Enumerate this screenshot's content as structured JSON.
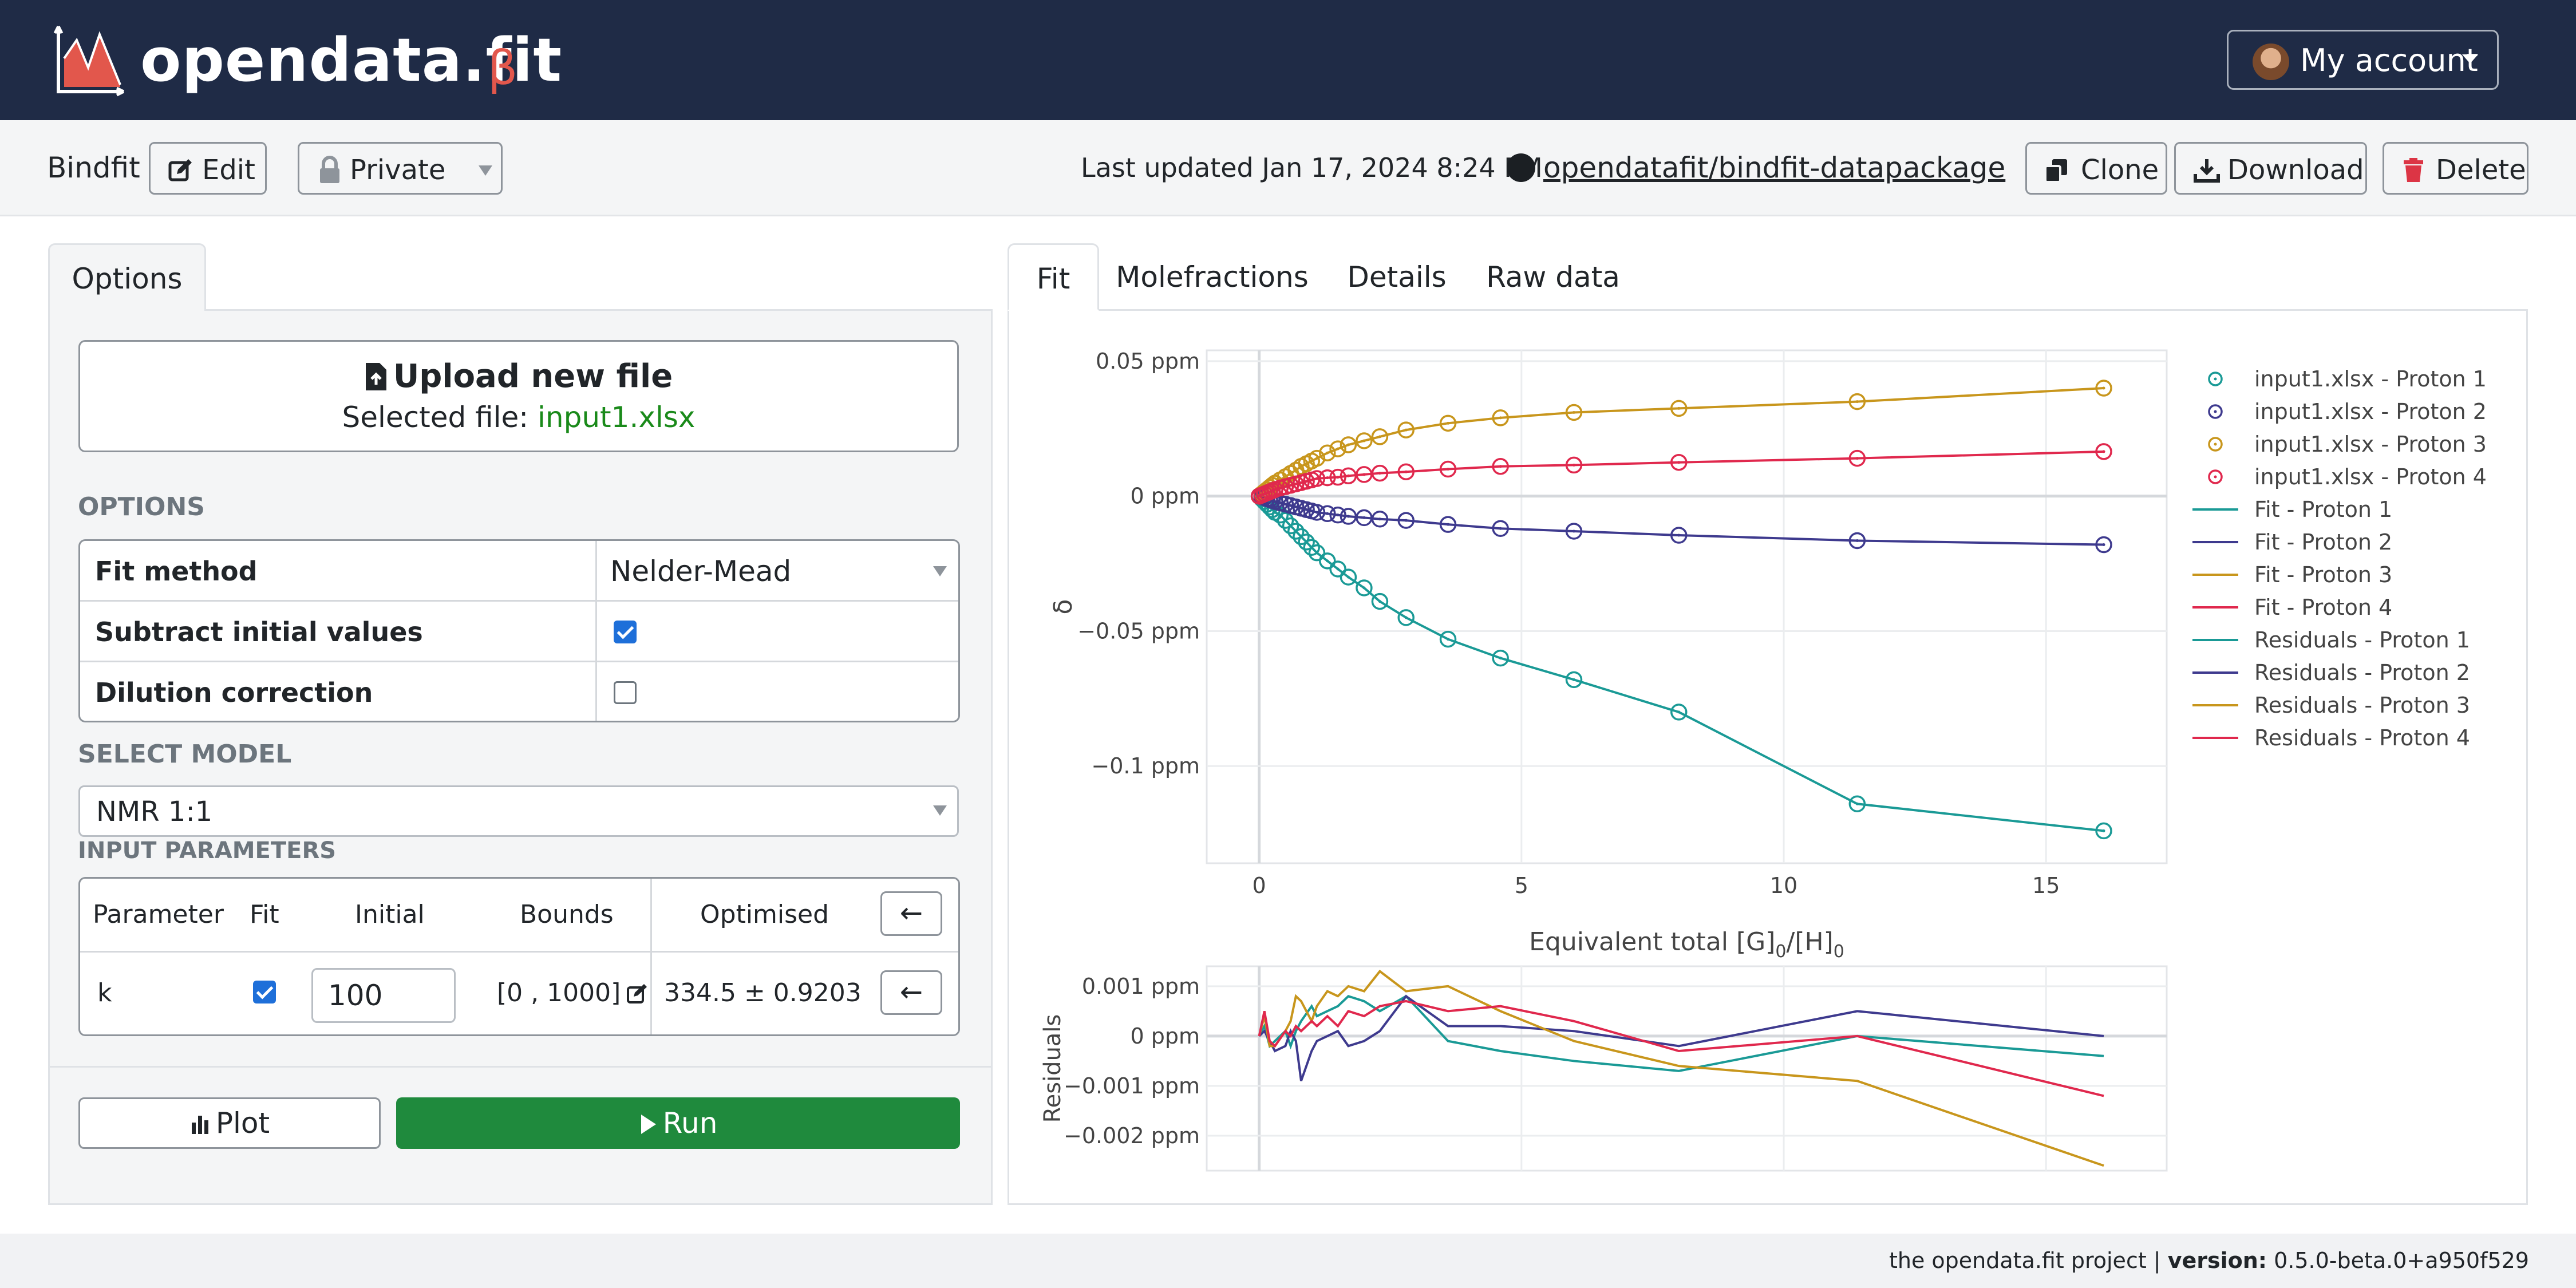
{
  "brand": {
    "name": "opendata.fit",
    "beta": "β"
  },
  "account": {
    "label": "My account"
  },
  "toolbar": {
    "project_name": "Bindfit",
    "edit_label": "Edit",
    "visibility": "Private",
    "last_updated": "Last updated Jan 17, 2024 8:24 PM",
    "repo": "opendatafit/bindfit-datapackage",
    "clone_label": "Clone",
    "download_label": "Download",
    "delete_label": "Delete"
  },
  "left": {
    "tab": "Options",
    "upload_title": "Upload new file",
    "selected_prefix": "Selected file: ",
    "selected_file": "input1.xlsx",
    "options_heading": "OPTIONS",
    "options": [
      {
        "label": "Fit method",
        "value": "Nelder-Mead"
      },
      {
        "label": "Subtract initial values",
        "checked": true
      },
      {
        "label": "Dilution correction",
        "checked": false
      }
    ],
    "model_heading": "SELECT MODEL",
    "model_value": "NMR 1:1",
    "params_heading": "INPUT PARAMETERS",
    "param_headers": [
      "Parameter",
      "Fit",
      "Initial",
      "Bounds",
      "Optimised"
    ],
    "param_row": {
      "name": "k",
      "fit": true,
      "initial": "100",
      "bounds": "[0 , 1000]",
      "optimised": "334.5 ± 0.9203"
    },
    "arrow": "←",
    "plot_label": "Plot",
    "run_label": "Run"
  },
  "right": {
    "tabs": [
      "Fit",
      "Molefractions",
      "Details",
      "Raw data"
    ],
    "active_tab": "Fit"
  },
  "chart_data": [
    {
      "type": "scatter",
      "title": "",
      "xlabel": "Equivalent total [G]0/[H]0",
      "ylabel": "δ",
      "xlim": [
        -1,
        17.3
      ],
      "ylim": [
        -0.136,
        0.054
      ],
      "x_ticks": [
        "0",
        "5",
        "10",
        "15"
      ],
      "y_ticks": [
        "0.05 ppm",
        "0 ppm",
        "−0.05 ppm",
        "−0.1 ppm"
      ],
      "x": [
        0,
        0.05,
        0.1,
        0.15,
        0.2,
        0.25,
        0.3,
        0.4,
        0.5,
        0.6,
        0.7,
        0.8,
        0.9,
        1.0,
        1.1,
        1.3,
        1.5,
        1.7,
        2.0,
        2.3,
        2.8,
        3.6,
        4.6,
        6.0,
        8.0,
        11.4,
        16.1
      ],
      "series": [
        {
          "name": "input1.xlsx - Proton 1",
          "color": "#1a9a96",
          "values": [
            0,
            -0.001,
            -0.002,
            -0.003,
            -0.004,
            -0.005,
            -0.006,
            -0.007,
            -0.009,
            -0.011,
            -0.013,
            -0.015,
            -0.017,
            -0.019,
            -0.021,
            -0.024,
            -0.027,
            -0.03,
            -0.034,
            -0.039,
            -0.045,
            -0.053,
            -0.06,
            -0.068,
            -0.08,
            -0.114,
            -0.124
          ]
        },
        {
          "name": "input1.xlsx - Proton 2",
          "color": "#3e3a8e",
          "values": [
            0,
            -0.0003,
            -0.0006,
            -0.001,
            -0.0013,
            -0.0016,
            -0.002,
            -0.0025,
            -0.003,
            -0.0035,
            -0.004,
            -0.0045,
            -0.005,
            -0.0055,
            -0.006,
            -0.0065,
            -0.007,
            -0.0075,
            -0.008,
            -0.0085,
            -0.009,
            -0.0105,
            -0.012,
            -0.013,
            -0.0145,
            -0.0165,
            -0.018
          ]
        },
        {
          "name": "input1.xlsx - Proton 3",
          "color": "#c8961c",
          "values": [
            0,
            0.0008,
            0.0016,
            0.0024,
            0.0032,
            0.004,
            0.0048,
            0.006,
            0.0072,
            0.0084,
            0.0096,
            0.011,
            0.012,
            0.013,
            0.014,
            0.016,
            0.0175,
            0.019,
            0.0205,
            0.022,
            0.0245,
            0.027,
            0.029,
            0.031,
            0.0325,
            0.035,
            0.04
          ]
        },
        {
          "name": "input1.xlsx - Proton 4",
          "color": "#e0284d",
          "values": [
            0,
            0.0004,
            0.0008,
            0.0012,
            0.0016,
            0.002,
            0.0024,
            0.003,
            0.0035,
            0.004,
            0.0045,
            0.005,
            0.0055,
            0.006,
            0.0065,
            0.0068,
            0.007,
            0.0075,
            0.008,
            0.0085,
            0.009,
            0.01,
            0.011,
            0.0115,
            0.0125,
            0.014,
            0.0165
          ]
        }
      ],
      "fit_series": [
        {
          "name": "Fit - Proton 1",
          "color": "#1a9a96"
        },
        {
          "name": "Fit - Proton 2",
          "color": "#3e3a8e"
        },
        {
          "name": "Fit - Proton 3",
          "color": "#c8961c"
        },
        {
          "name": "Fit - Proton 4",
          "color": "#e0284d"
        }
      ],
      "residual_series": [
        {
          "name": "Residuals - Proton 1",
          "color": "#1a9a96"
        },
        {
          "name": "Residuals - Proton 2",
          "color": "#3e3a8e"
        },
        {
          "name": "Residuals - Proton 3",
          "color": "#c8961c"
        },
        {
          "name": "Residuals - Proton 4",
          "color": "#e0284d"
        }
      ],
      "legend": "right"
    },
    {
      "type": "line",
      "title": "",
      "xlabel": "",
      "ylabel": "Residuals",
      "xlim": [
        -1,
        17.3
      ],
      "ylim": [
        -0.0027,
        0.0014
      ],
      "y_ticks": [
        "0.001 ppm",
        "0 ppm",
        "−0.001 ppm",
        "−0.002 ppm"
      ],
      "x": [
        0,
        0.1,
        0.2,
        0.3,
        0.5,
        0.6,
        0.7,
        0.8,
        1.0,
        1.1,
        1.3,
        1.5,
        1.7,
        2.0,
        2.3,
        2.8,
        3.6,
        4.6,
        6.0,
        8.0,
        11.4,
        16.1
      ],
      "series": [
        {
          "name": "Residuals - Proton 1",
          "color": "#1a9a96",
          "values": [
            0,
            0.0002,
            -0.0002,
            -0.0001,
            0.0001,
            -0.0002,
            0.0001,
            0.0003,
            0.0006,
            0.0004,
            0.0005,
            0.0006,
            0.0008,
            0.0007,
            0.0005,
            0.0008,
            -0.0001,
            -0.0003,
            -0.0005,
            -0.0007,
            0.0,
            -0.0004
          ]
        },
        {
          "name": "Residuals - Proton 2",
          "color": "#3e3a8e",
          "values": [
            0,
            0.0001,
            -0.0001,
            -0.0003,
            -0.0002,
            0.0001,
            -0.0001,
            -0.0009,
            -0.0003,
            -0.0001,
            0.0,
            0.0001,
            -0.0002,
            -0.0001,
            0.0001,
            0.0008,
            0.0002,
            0.0002,
            0.0001,
            -0.0002,
            0.0005,
            0.0
          ]
        },
        {
          "name": "Residuals - Proton 3",
          "color": "#c8961c",
          "values": [
            0,
            0.0004,
            -0.0002,
            -0.0002,
            0.0001,
            0.0003,
            0.0008,
            0.0007,
            0.0003,
            0.0006,
            0.0009,
            0.0008,
            0.001,
            0.0009,
            0.0013,
            0.0009,
            0.001,
            0.0005,
            -0.0001,
            -0.0006,
            -0.0009,
            -0.0026
          ]
        },
        {
          "name": "Residuals - Proton 4",
          "color": "#e0284d",
          "values": [
            0,
            0.0005,
            -0.0001,
            -0.0002,
            0.0001,
            0.0,
            0.0002,
            0.0001,
            0.0003,
            0.0002,
            0.0004,
            0.0002,
            0.0005,
            0.0004,
            0.0006,
            0.0007,
            0.0005,
            0.0006,
            0.0003,
            -0.0003,
            0.0,
            -0.0012
          ]
        }
      ]
    }
  ],
  "footer": {
    "project": "the opendata.fit project | ",
    "version_label": "version:",
    "version_value": " 0.5.0-beta.0+a950f529"
  }
}
